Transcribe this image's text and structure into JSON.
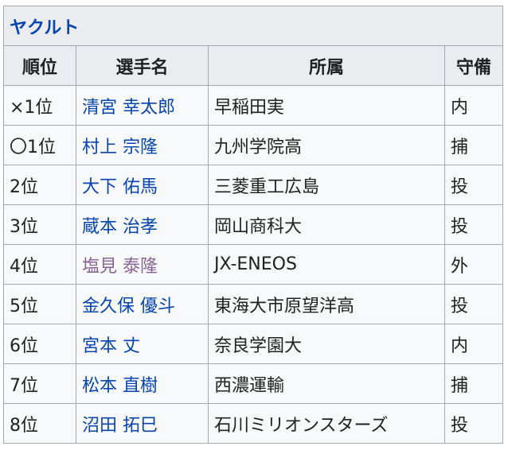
{
  "team": {
    "name": "ヤクルト",
    "color": "#0645ad"
  },
  "columns": {
    "rank": "順位",
    "player": "選手名",
    "affiliation": "所属",
    "position": "守備"
  },
  "rows": [
    {
      "rank": "×1位",
      "player": "清宮 幸太郎",
      "affiliation": "早稲田実",
      "position": "内"
    },
    {
      "rank": "〇1位",
      "player": "村上 宗隆",
      "affiliation": "九州学院高",
      "position": "捕"
    },
    {
      "rank": "2位",
      "player": "大下 佑馬",
      "affiliation": "三菱重工広島",
      "position": "投"
    },
    {
      "rank": "3位",
      "player": "蔵本 治孝",
      "affiliation": "岡山商科大",
      "position": "投"
    },
    {
      "rank": "4位",
      "player": "塩見 泰隆",
      "affiliation": "JX-ENEOS",
      "position": "外"
    },
    {
      "rank": "5位",
      "player": "金久保 優斗",
      "affiliation": "東海大市原望洋高",
      "position": "投"
    },
    {
      "rank": "6位",
      "player": "宮本 丈",
      "affiliation": "奈良学園大",
      "position": "内"
    },
    {
      "rank": "7位",
      "player": "松本 直樹",
      "affiliation": "西濃運輸",
      "position": "捕"
    },
    {
      "rank": "8位",
      "player": "沼田 拓巳",
      "affiliation": "石川ミリオンスターズ",
      "position": "投"
    }
  ],
  "colors": {
    "link": "#0645ad",
    "visited_link": "#8a6496",
    "header_bg": "#eaecf0",
    "cell_bg": "#f8f9fa",
    "border": "#a2a9b1"
  }
}
